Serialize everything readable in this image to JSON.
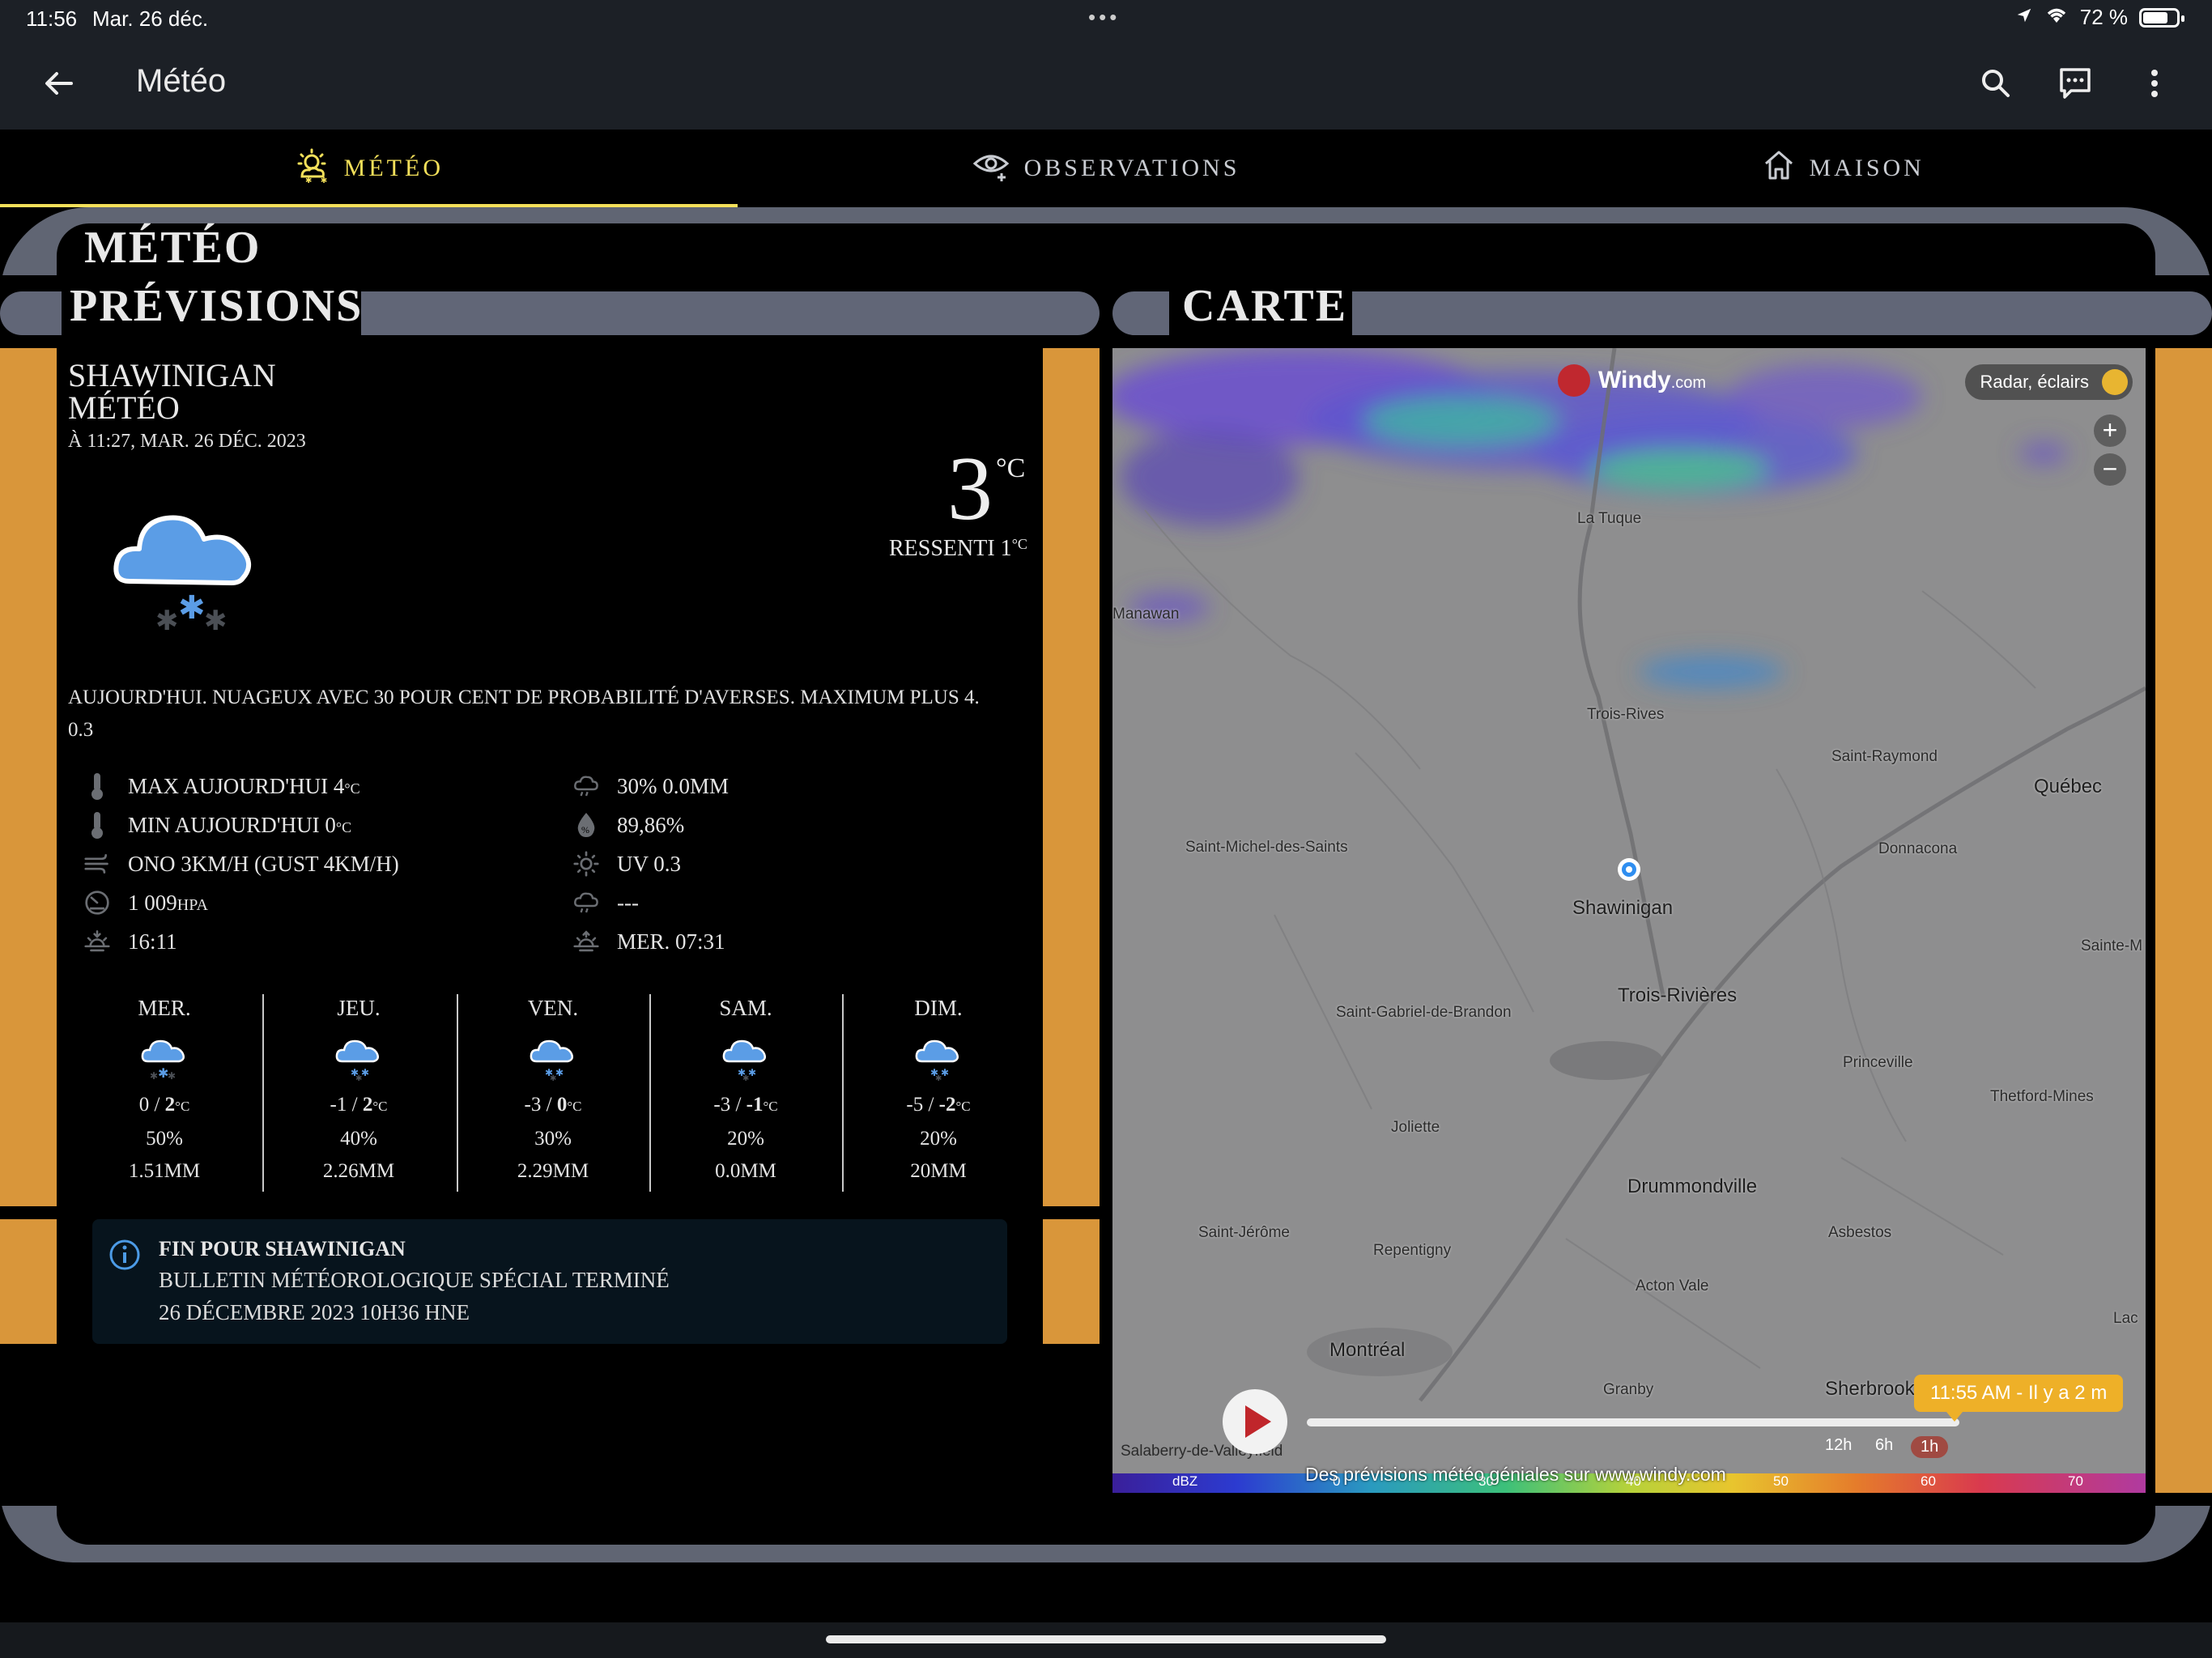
{
  "status": {
    "time": "11:56",
    "date": "Mar. 26 déc.",
    "dots": "•••",
    "battery": "72 %"
  },
  "appbar": {
    "title": "Météo",
    "back_icon": "arrow-left-icon",
    "icons": [
      "search-icon",
      "chat-icon",
      "more-vertical-icon"
    ]
  },
  "tabs": [
    {
      "label": "MÉTÉO",
      "icon": "sun-snow-icon",
      "active": true
    },
    {
      "label": "OBSERVATIONS",
      "icon": "eye-icon",
      "active": false
    },
    {
      "label": "MAISON",
      "icon": "home-icon",
      "active": false
    }
  ],
  "headings": {
    "meteo": "MÉTÉO",
    "previsions": "PRÉVISIONS",
    "carte": "CARTE"
  },
  "current": {
    "city": "SHAWINIGAN",
    "subtitle": "MÉTÉO",
    "timestamp": "À 11:27, MAR. 26 DÉC. 2023",
    "temp": "3",
    "unit": "°C",
    "feels": "RESSENTI 1",
    "feels_unit": "°C",
    "summary": "AUJOURD'HUI. NUAGEUX AVEC 30 POUR CENT DE PROBABILITÉ D'AVERSES. MAXIMUM PLUS 4.",
    "summary_extra": "0.3"
  },
  "stats_left": [
    {
      "icon": "thermometer-icon",
      "text": "MAX AUJOURD'HUI 4",
      "unit": "°C"
    },
    {
      "icon": "thermometer-icon",
      "text": "MIN AUJOURD'HUI 0",
      "unit": "°C"
    },
    {
      "icon": "wind-icon",
      "text": "ONO 3KM/H (GUST 4KM/H)",
      "unit": ""
    },
    {
      "icon": "gauge-icon",
      "text": "1 009",
      "unit": "HPA"
    },
    {
      "icon": "sunset-icon",
      "text": "16:11",
      "unit": ""
    }
  ],
  "stats_right": [
    {
      "icon": "rain-cloud-icon",
      "text": "30% 0.0MM"
    },
    {
      "icon": "humidity-icon",
      "text": "89,86%"
    },
    {
      "icon": "uv-sun-icon",
      "text": "UV 0.3"
    },
    {
      "icon": "rain-cloud-icon",
      "text": "---"
    },
    {
      "icon": "sunrise-icon",
      "text": "MER. 07:31"
    }
  ],
  "days": [
    {
      "name": "MER.",
      "lo": "0",
      "hi": "2",
      "unit": "°C",
      "pop": "50%",
      "precip": "1.51MM"
    },
    {
      "name": "JEU.",
      "lo": "-1",
      "hi": "2",
      "unit": "°C",
      "pop": "40%",
      "precip": "2.26MM"
    },
    {
      "name": "VEN.",
      "lo": "-3",
      "hi": "0",
      "unit": "°C",
      "pop": "30%",
      "precip": "2.29MM"
    },
    {
      "name": "SAM.",
      "lo": "-3",
      "hi": "-1",
      "unit": "°C",
      "pop": "20%",
      "precip": "0.0MM"
    },
    {
      "name": "DIM.",
      "lo": "-5",
      "hi": "-2",
      "unit": "°C",
      "pop": "20%",
      "precip": "20MM"
    }
  ],
  "alert": {
    "title": "FIN POUR SHAWINIGAN",
    "line1": "BULLETIN MÉTÉOROLOGIQUE SPÉCIAL TERMINÉ",
    "line2": "26 DÉCEMBRE 2023 10H36 HNE"
  },
  "map": {
    "brand": "Windy",
    "brand_suffix": ".com",
    "layer_button": "Radar, éclairs",
    "time_tip": "11:55 AM - Il y a 2 m",
    "promo": "Des prévisions météo géniales sur www.windy.com",
    "resolutions": [
      "12h",
      "6h",
      "1h"
    ],
    "legend": [
      "dBZ",
      "0",
      "30",
      "40",
      "50",
      "60",
      "70"
    ],
    "places": [
      {
        "name": "La Tuque",
        "big": false
      },
      {
        "name": "Manawan",
        "big": false
      },
      {
        "name": "Trois-Rives",
        "big": false
      },
      {
        "name": "Saint-Raymond",
        "big": false
      },
      {
        "name": "Québec",
        "big": true
      },
      {
        "name": "Saint-Michel-des-Saints",
        "big": false
      },
      {
        "name": "Donnacona",
        "big": false
      },
      {
        "name": "Shawinigan",
        "big": true
      },
      {
        "name": "Sainte-M",
        "big": false
      },
      {
        "name": "Trois-Rivières",
        "big": true
      },
      {
        "name": "Saint-Gabriel-de-Brandon",
        "big": false
      },
      {
        "name": "Princeville",
        "big": false
      },
      {
        "name": "Thetford-Mines",
        "big": false
      },
      {
        "name": "Joliette",
        "big": false
      },
      {
        "name": "Drummondville",
        "big": true
      },
      {
        "name": "Saint-Jérôme",
        "big": false
      },
      {
        "name": "Repentigny",
        "big": false
      },
      {
        "name": "Asbestos",
        "big": false
      },
      {
        "name": "Acton Vale",
        "big": false
      },
      {
        "name": "Lac",
        "big": false
      },
      {
        "name": "Montréal",
        "big": true
      },
      {
        "name": "Granby",
        "big": false
      },
      {
        "name": "Sherbrook",
        "big": true
      },
      {
        "name": "Salaberry-de-Valleyfield",
        "big": false
      }
    ]
  }
}
